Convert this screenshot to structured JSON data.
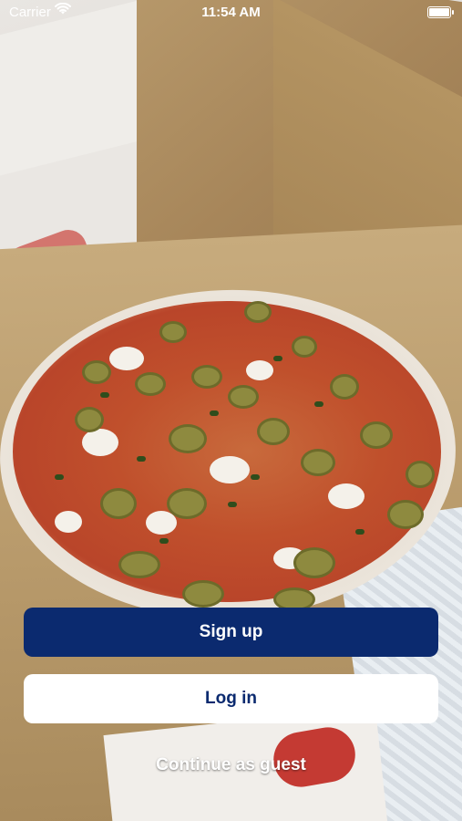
{
  "status_bar": {
    "carrier": "Carrier",
    "time": "11:54 AM",
    "wifi_icon": "wifi-icon",
    "battery_icon": "battery-icon"
  },
  "background": {
    "image": "pizza-in-box-photo"
  },
  "actions": {
    "signup_label": "Sign up",
    "login_label": "Log in",
    "guest_label": "Continue as guest"
  },
  "colors": {
    "primary": "#0b2a6f",
    "button_light": "#ffffff",
    "text_light": "#ffffff"
  }
}
